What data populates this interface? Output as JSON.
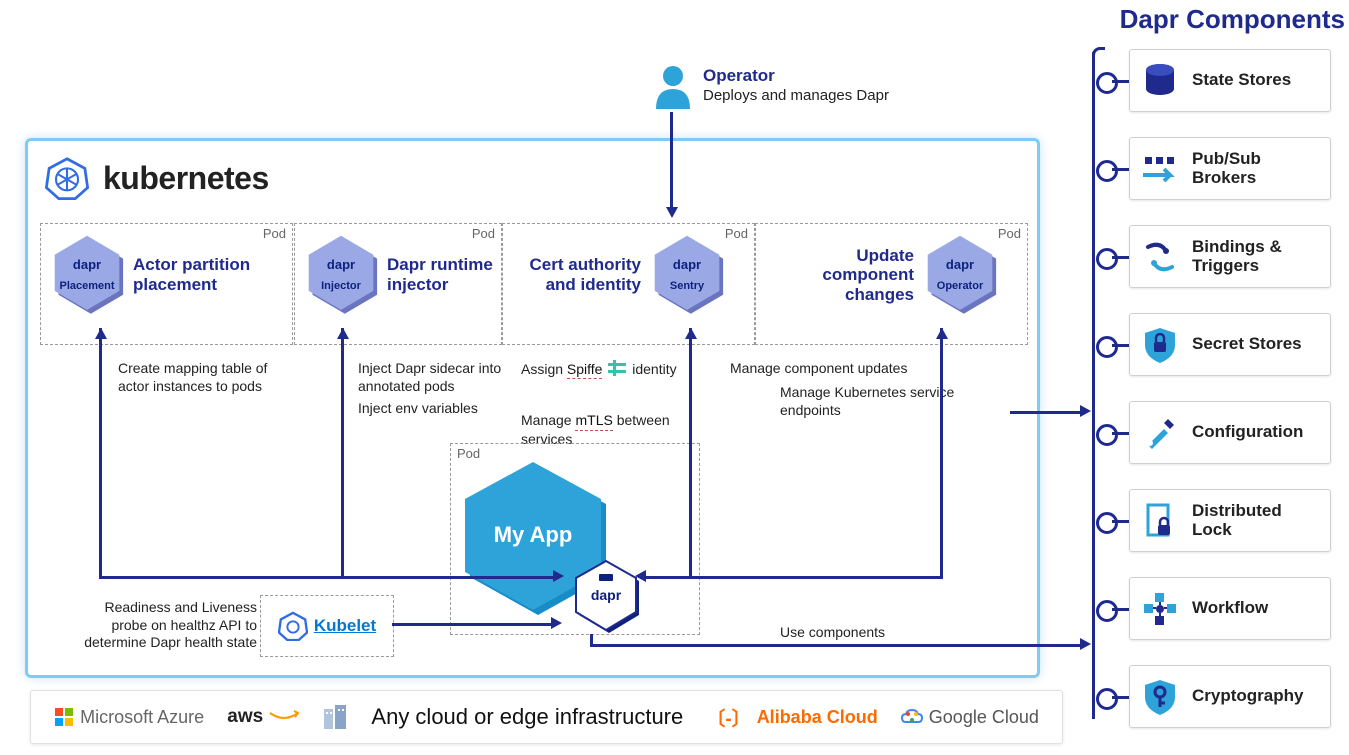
{
  "title_right": "Dapr Components",
  "kubernetes": {
    "title": "kubernetes"
  },
  "operator": {
    "name": "Operator",
    "desc": "Deploys and manages Dapr"
  },
  "pods": {
    "placement": {
      "hex_top": "dapr",
      "hex_bot": "Placement",
      "text": "Actor partition placement",
      "label": "Pod"
    },
    "injector": {
      "hex_top": "dapr",
      "hex_bot": "Injector",
      "text": "Dapr runtime injector",
      "label": "Pod"
    },
    "sentry": {
      "hex_top": "dapr",
      "hex_bot": "Sentry",
      "text": "Cert authority and identity",
      "label": "Pod"
    },
    "operator": {
      "hex_top": "dapr",
      "hex_bot": "Operator",
      "text": "Update component changes",
      "label": "Pod"
    }
  },
  "app_pod": {
    "label": "Pod",
    "app_name": "My App",
    "sidecar": "dapr"
  },
  "kubelet": {
    "label": "Kubelet"
  },
  "descriptions": {
    "placement": "Create mapping table of actor instances to pods",
    "injector_1": "Inject Dapr sidecar into annotated pods",
    "injector_2": "Inject env variables",
    "sentry_1a": "Assign ",
    "sentry_1b": "Spiffe",
    "sentry_1c": " identity",
    "sentry_2a": "Manage ",
    "sentry_2b": "mTLS",
    "sentry_2c": " between services",
    "operator_1": "Manage component updates",
    "operator_2": "Manage Kubernetes service endpoints",
    "kubelet": "Readiness and Liveness probe on healthz API to determine Dapr health state",
    "use_components": "Use components"
  },
  "cloud_bar": {
    "azure": "Microsoft Azure",
    "aws": "aws",
    "center": "Any cloud or edge infrastructure",
    "alibaba": "Alibaba Cloud",
    "google": "Google Cloud"
  },
  "components": [
    {
      "label": "State Stores"
    },
    {
      "label": "Pub/Sub Brokers"
    },
    {
      "label": "Bindings & Triggers"
    },
    {
      "label": "Secret Stores"
    },
    {
      "label": "Configuration"
    },
    {
      "label": "Distributed Lock"
    },
    {
      "label": "Workflow"
    },
    {
      "label": "Cryptography"
    }
  ]
}
